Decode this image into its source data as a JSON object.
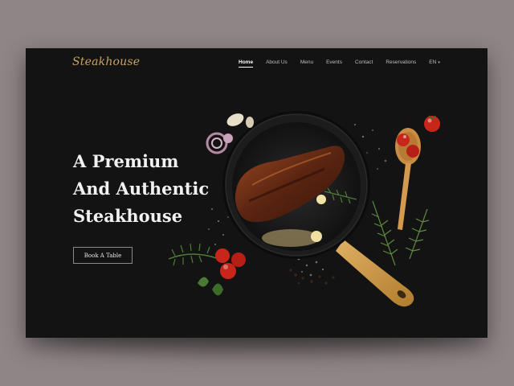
{
  "brand": {
    "logo_text": "Steakhouse",
    "accent": "#c9a35f"
  },
  "nav": {
    "items": [
      {
        "label": "Home",
        "active": true
      },
      {
        "label": "About Us"
      },
      {
        "label": "Menu"
      },
      {
        "label": "Events"
      },
      {
        "label": "Contact"
      },
      {
        "label": "Reservations"
      }
    ],
    "language": "EN"
  },
  "hero": {
    "title_lines": [
      "A Premium",
      "And Authentic",
      "Steakhouse"
    ],
    "cta_label": "Book A Table"
  },
  "colors": {
    "background": "#131313",
    "page": "#8f8587",
    "pan": "#1c1c1c",
    "handle": "#d7a253",
    "tomato": "#c8261b",
    "herb": "#4f7d3a"
  },
  "icons": [
    "skillet-illustration",
    "tomato-icon",
    "herb-icon",
    "garlic-icon",
    "onion-icon",
    "wooden-spoon-icon"
  ]
}
